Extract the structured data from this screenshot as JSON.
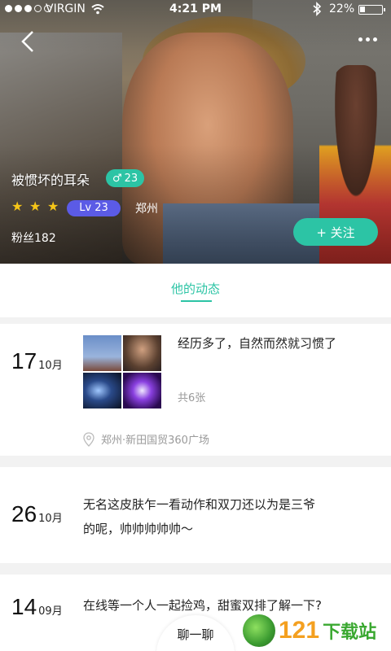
{
  "status_bar": {
    "carrier": "VIRGIN",
    "time": "4:21 PM",
    "battery_percent": "22%",
    "battery_level": 0.22,
    "signal_bars_filled": 3,
    "signal_bars_total": 5
  },
  "header": {
    "back_icon": "chevron-left-icon",
    "more_icon": "more-dots-icon"
  },
  "profile": {
    "nickname": "被惯坏的耳朵",
    "gender_symbol": "♂",
    "age": "23",
    "stars": 3,
    "level": "Lv 23",
    "city": "郑州",
    "fans": "粉丝182",
    "follow_label": "+ 关注"
  },
  "tab": {
    "label": "他的动态"
  },
  "posts": [
    {
      "day": "17",
      "month": "10月",
      "text": "经历多了，自然而然就习惯了",
      "photo_count": "共6张",
      "location": "郑州·新田国贸360广场"
    },
    {
      "day": "26",
      "month": "10月",
      "text_line1": "无名这皮肤乍一看动作和双刀还以为是三爷",
      "text_line2": "的呢，帅帅帅帅帅～"
    },
    {
      "day": "14",
      "month": "09月",
      "text": "在线等一个人一起捡鸡，甜蜜双排了解一下?"
    }
  ],
  "chat_button": "聊一聊",
  "watermark": {
    "num": "121",
    "cn": "下载站"
  },
  "colors": {
    "accent": "#2cc4a5",
    "level": "#5b5be6",
    "star": "#f5c518"
  }
}
